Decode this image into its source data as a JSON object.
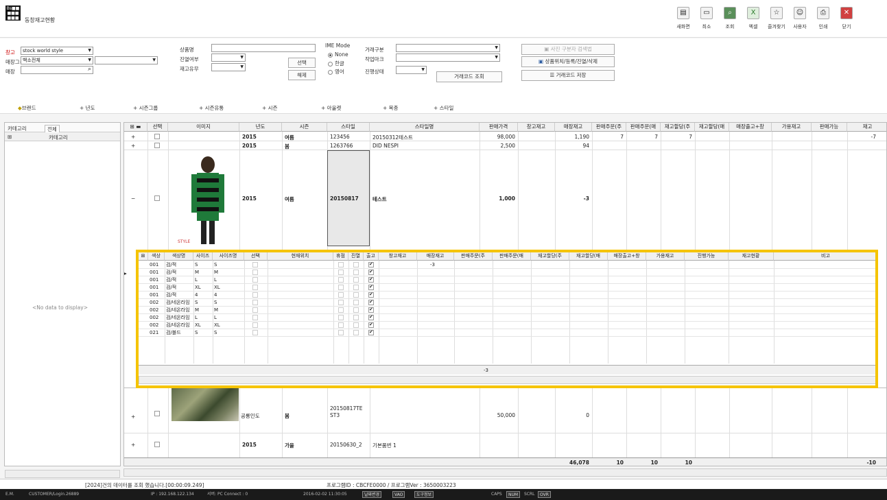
{
  "app": {
    "logo_text": "Bs■■ ■■■ ■■■",
    "title": "동창재고현황"
  },
  "toolbar": [
    {
      "label": "새화면",
      "icon": "new-window-icon"
    },
    {
      "label": "최소",
      "icon": "minimize-icon"
    },
    {
      "label": "조회",
      "icon": "search-icon"
    },
    {
      "label": "엑셀",
      "icon": "excel-icon"
    },
    {
      "label": "즐겨찾기",
      "icon": "favorite-icon"
    },
    {
      "label": "사용자",
      "icon": "user-icon"
    },
    {
      "label": "인쇄",
      "icon": "print-icon"
    },
    {
      "label": "닫기",
      "icon": "close-icon"
    }
  ],
  "filters": {
    "warehouse_label": "창고",
    "warehouse_value": "stock world style",
    "group_label": "매장그룹",
    "group_value": "백소전체",
    "store_label": "매장",
    "store_value": "",
    "product_label": "상품명",
    "product_value": "",
    "display_label": "진열여부",
    "display_value": "",
    "stock_label": "재고유무",
    "stock_value": "",
    "select_btn": "선택",
    "release_btn": "해제",
    "ime_label": "IME Mode",
    "ime_options": [
      "None",
      "한글",
      "영어"
    ],
    "ime_selected": "None",
    "type_label": "거래구분",
    "type_value": "",
    "work_label": "작업마크",
    "work_value": "",
    "status_label": "진행상태",
    "status_value": "",
    "register_btn": "거래코드 조회",
    "right_btn1": "사진 구분자 검색법",
    "right_btn2": "상품위치/등록/진열/삭제",
    "right_btn3": "거래코드 저장"
  },
  "tabs": [
    "브랜드",
    "년도",
    "시즌그룹",
    "시즌유통",
    "시즌",
    "아울렛",
    "복종",
    "스타일"
  ],
  "left_panel": {
    "tabs": [
      "카테고리",
      "전체"
    ],
    "column": "카테고리",
    "empty_text": "<No data to display>"
  },
  "grid": {
    "columns": [
      "선택",
      "이미지",
      "년도",
      "시즌",
      "스타일",
      "스타일명",
      "판매가격",
      "창고재고",
      "매장재고",
      "판매주문(주",
      "판매주문(매",
      "재고할당(주",
      "재고할당(매",
      "매장출고+창",
      "가용재고",
      "판매가능",
      "재고"
    ],
    "rows": [
      {
        "year": "2015",
        "season": "여름",
        "style": "123456",
        "name": "20150312테스트",
        "price": "98,000",
        "store_stock": "1,190",
        "o1": "7",
        "o2": "7",
        "a1": "7",
        "avail": "-7"
      },
      {
        "year": "2015",
        "season": "봄",
        "style": "1263766",
        "name": "DID NESPI",
        "price": "2,500",
        "store_stock": "94"
      },
      {
        "year": "2015",
        "season": "여름",
        "style": "20150817",
        "name": "테스트",
        "price": "1,000",
        "store_stock": "-3"
      },
      {
        "year": "",
        "season": "봄",
        "style": "20150817TE ST3",
        "name": "공룡인도",
        "price": "50,000",
        "store_stock": "0"
      },
      {
        "year": "2015",
        "season": "가을",
        "style": "20150630_2",
        "name": "기본품번 1",
        "price": "",
        "store_stock": ""
      }
    ],
    "totals": {
      "store_stock": "46,078",
      "o1": "10",
      "o2": "10",
      "a1": "10",
      "avail": "-10"
    }
  },
  "subgrid": {
    "columns": [
      "색상",
      "색상명",
      "사이즈",
      "사이즈명",
      "선택",
      "현재위치",
      "휴점",
      "진열",
      "출고",
      "창고재고",
      "매장재고",
      "판매주문(주",
      "판매주문(매",
      "재고할당(주",
      "재고할당(매",
      "매장출고+창",
      "가용재고",
      "진행가능",
      "재고현황",
      "비고"
    ],
    "rows": [
      {
        "color": "001",
        "cname": "검/적",
        "size": "S",
        "sname": "S",
        "stock": "-3"
      },
      {
        "color": "001",
        "cname": "검/적",
        "size": "M",
        "sname": "M",
        "stock": ""
      },
      {
        "color": "001",
        "cname": "검/적",
        "size": "L",
        "sname": "L",
        "stock": ""
      },
      {
        "color": "001",
        "cname": "검/적",
        "size": "XL",
        "sname": "XL",
        "stock": ""
      },
      {
        "color": "001",
        "cname": "검/적",
        "size": "4",
        "sname": "4",
        "stock": ""
      },
      {
        "color": "002",
        "cname": "검/네온라임",
        "size": "S",
        "sname": "S",
        "stock": ""
      },
      {
        "color": "002",
        "cname": "검/네온라임",
        "size": "M",
        "sname": "M",
        "stock": ""
      },
      {
        "color": "002",
        "cname": "검/네온라임",
        "size": "L",
        "sname": "L",
        "stock": ""
      },
      {
        "color": "002",
        "cname": "검/네온라임",
        "size": "XL",
        "sname": "XL",
        "stock": ""
      },
      {
        "color": "021",
        "cname": "검/블드",
        "size": "S",
        "sname": "S",
        "stock": ""
      }
    ],
    "total": "-3"
  },
  "status": {
    "left": "[2024]건의 데이터를 조회 했습니다.[00:00:09.249]",
    "right": "프로그램ID : CBCFE0000 / 프로그램Ver : 3650003223"
  },
  "taskbar": [
    "E.M.",
    "CUSTOMER/Login.26889",
    "IP : 192.168.122.134",
    "서버: PC Connect : 0",
    "2016-02-02 11:30:05",
    "날짜변경",
    "VAO",
    "도구정보",
    "CAPS",
    "NUM",
    "SCRL",
    "OVR"
  ],
  "colors": {
    "highlight": "#f5c400"
  }
}
